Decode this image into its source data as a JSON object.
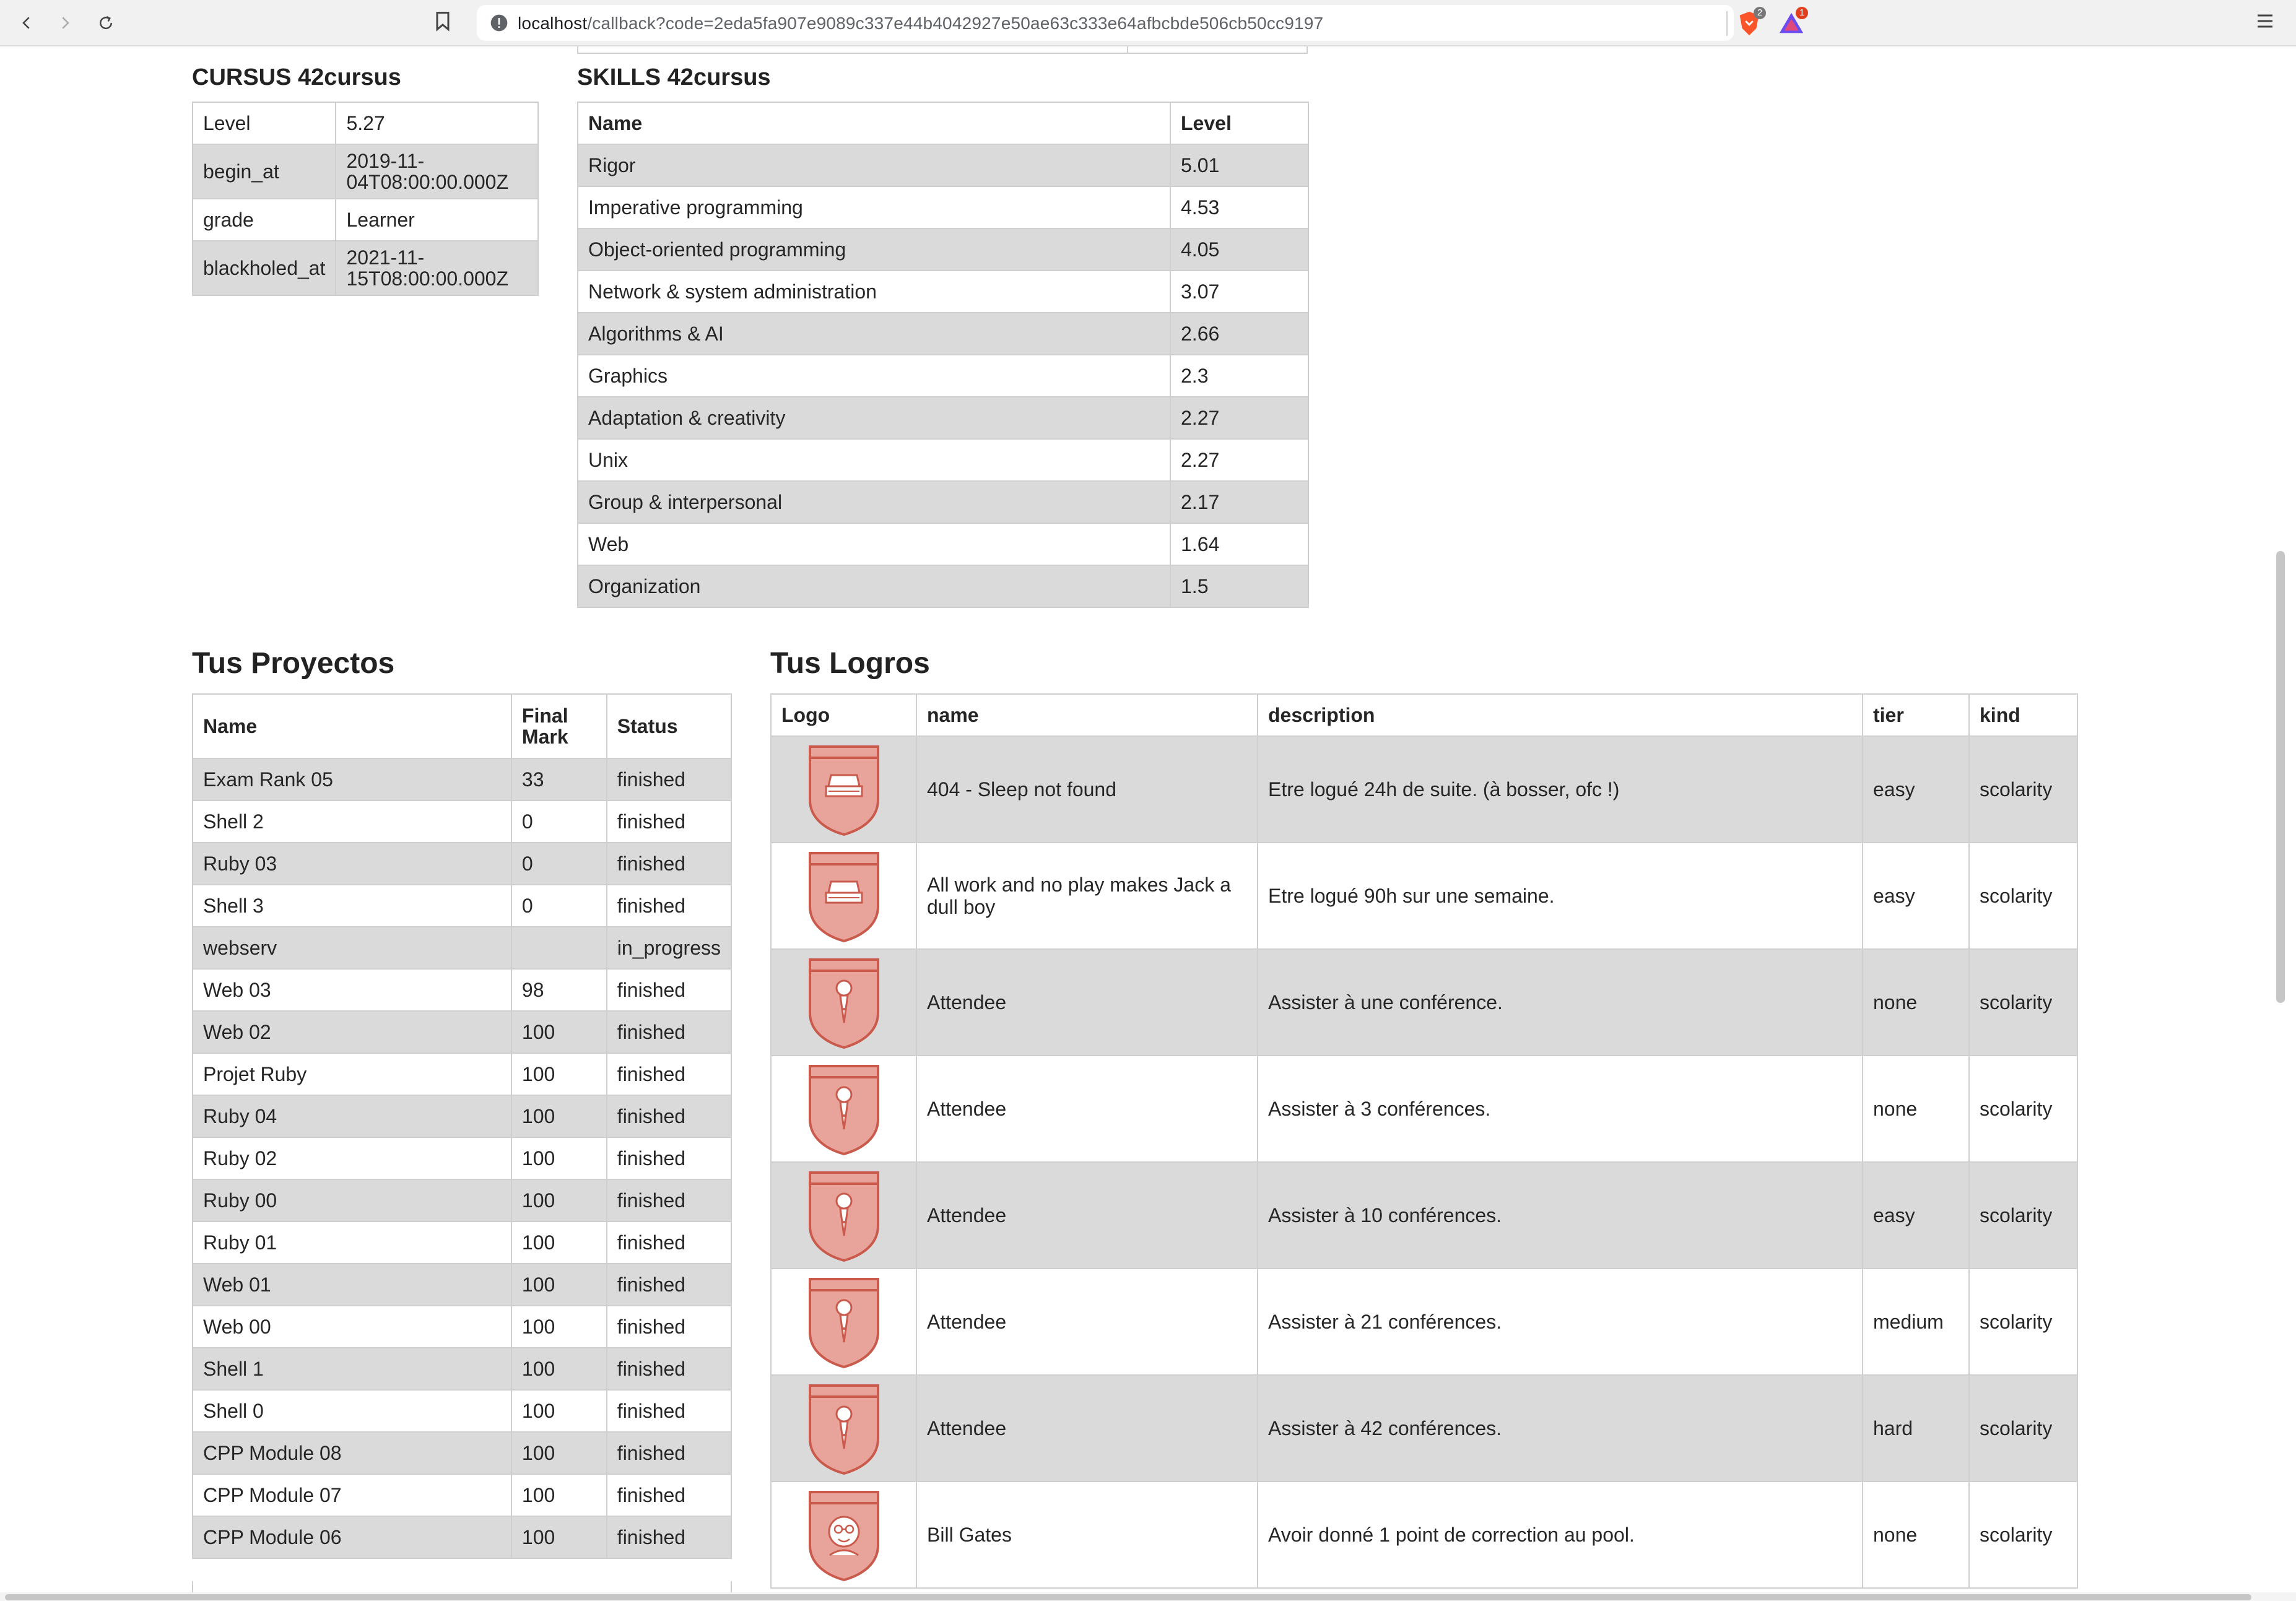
{
  "browser": {
    "url_host": "localhost",
    "url_path": "/callback?code=2eda5fa907e9089c337e44b4042927e50ae63c333e64afbcbde506cb50cc9197",
    "brave_shields_count": "2",
    "rewards_count": "1"
  },
  "cursus": {
    "title": "CURSUS 42cursus",
    "rows": [
      {
        "key": "Level",
        "value": "5.27"
      },
      {
        "key": "begin_at",
        "value": "2019-11-04T08:00:00.000Z"
      },
      {
        "key": "grade",
        "value": "Learner"
      },
      {
        "key": "blackholed_at",
        "value": "2021-11-15T08:00:00.000Z"
      }
    ]
  },
  "skills": {
    "title": "SKILLS 42cursus",
    "headers": {
      "name": "Name",
      "level": "Level"
    },
    "rows": [
      {
        "name": "Rigor",
        "level": "5.01"
      },
      {
        "name": "Imperative programming",
        "level": "4.53"
      },
      {
        "name": "Object-oriented programming",
        "level": "4.05"
      },
      {
        "name": "Network & system administration",
        "level": "3.07"
      },
      {
        "name": "Algorithms & AI",
        "level": "2.66"
      },
      {
        "name": "Graphics",
        "level": "2.3"
      },
      {
        "name": "Adaptation & creativity",
        "level": "2.27"
      },
      {
        "name": "Unix",
        "level": "2.27"
      },
      {
        "name": "Group & interpersonal",
        "level": "2.17"
      },
      {
        "name": "Web",
        "level": "1.64"
      },
      {
        "name": "Organization",
        "level": "1.5"
      }
    ]
  },
  "projects": {
    "title": "Tus Proyectos",
    "headers": {
      "name": "Name",
      "final_mark": "Final Mark",
      "status": "Status"
    },
    "rows": [
      {
        "name": "Exam Rank 05",
        "mark": "33",
        "status": "finished"
      },
      {
        "name": "Shell 2",
        "mark": "0",
        "status": "finished"
      },
      {
        "name": "Ruby 03",
        "mark": "0",
        "status": "finished"
      },
      {
        "name": "Shell 3",
        "mark": "0",
        "status": "finished"
      },
      {
        "name": "webserv",
        "mark": "",
        "status": "in_progress"
      },
      {
        "name": "Web 03",
        "mark": "98",
        "status": "finished"
      },
      {
        "name": "Web 02",
        "mark": "100",
        "status": "finished"
      },
      {
        "name": "Projet Ruby",
        "mark": "100",
        "status": "finished"
      },
      {
        "name": "Ruby 04",
        "mark": "100",
        "status": "finished"
      },
      {
        "name": "Ruby 02",
        "mark": "100",
        "status": "finished"
      },
      {
        "name": "Ruby 00",
        "mark": "100",
        "status": "finished"
      },
      {
        "name": "Ruby 01",
        "mark": "100",
        "status": "finished"
      },
      {
        "name": "Web 01",
        "mark": "100",
        "status": "finished"
      },
      {
        "name": "Web 00",
        "mark": "100",
        "status": "finished"
      },
      {
        "name": "Shell 1",
        "mark": "100",
        "status": "finished"
      },
      {
        "name": "Shell 0",
        "mark": "100",
        "status": "finished"
      },
      {
        "name": "CPP Module 08",
        "mark": "100",
        "status": "finished"
      },
      {
        "name": "CPP Module 07",
        "mark": "100",
        "status": "finished"
      },
      {
        "name": "CPP Module 06",
        "mark": "100",
        "status": "finished"
      }
    ]
  },
  "achievements": {
    "title": "Tus Logros",
    "headers": {
      "logo": "Logo",
      "name": "name",
      "description": "description",
      "tier": "tier",
      "kind": "kind"
    },
    "rows": [
      {
        "icon": "bed-badge-icon",
        "name": "404 - Sleep not found",
        "description": "Etre logué 24h de suite. (à bosser, ofc !)",
        "tier": "easy",
        "kind": "scolarity"
      },
      {
        "icon": "bed-badge-icon",
        "name": "All work and no play makes Jack a dull boy",
        "description": "Etre logué 90h sur une semaine.",
        "tier": "easy",
        "kind": "scolarity"
      },
      {
        "icon": "microphone-badge-icon",
        "name": "Attendee",
        "description": "Assister à une conférence.",
        "tier": "none",
        "kind": "scolarity"
      },
      {
        "icon": "microphone-badge-icon",
        "name": "Attendee",
        "description": "Assister à 3 conférences.",
        "tier": "none",
        "kind": "scolarity"
      },
      {
        "icon": "microphone-badge-icon",
        "name": "Attendee",
        "description": "Assister à 10 conférences.",
        "tier": "easy",
        "kind": "scolarity"
      },
      {
        "icon": "microphone-badge-icon",
        "name": "Attendee",
        "description": "Assister à 21 conférences.",
        "tier": "medium",
        "kind": "scolarity"
      },
      {
        "icon": "microphone-badge-icon",
        "name": "Attendee",
        "description": "Assister à 42 conférences.",
        "tier": "hard",
        "kind": "scolarity"
      },
      {
        "icon": "bill-gates-badge-icon",
        "name": "Bill Gates",
        "description": "Avoir donné 1 point de correction au pool.",
        "tier": "none",
        "kind": "scolarity"
      }
    ]
  },
  "colors": {
    "badge_fill": "#e8a49b",
    "badge_stroke": "#c95a4c",
    "row_shade": "#dadada"
  }
}
